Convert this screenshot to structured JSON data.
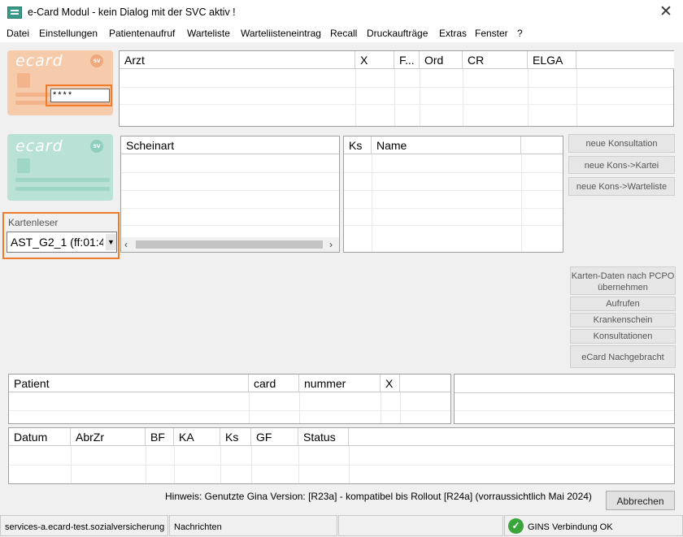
{
  "window": {
    "title": "e-Card Modul - kein Dialog mit der SVC aktiv !",
    "close_glyph": "✕"
  },
  "menu": [
    "Datei",
    "Einstellungen",
    "Patientenaufruf",
    "Warteliste",
    "Warteliisteneintrag",
    "Recall",
    "Druckaufträge",
    "Extras",
    "Fenster",
    "?"
  ],
  "ecard_top": {
    "logo": "ecard",
    "pin_value": "****",
    "sv": "sv"
  },
  "ecard_bottom": {
    "logo": "ecard",
    "sv": "sv"
  },
  "arzt_table": {
    "columns": [
      "Arzt",
      "X",
      "F...",
      "Ord",
      "CR",
      "ELGA"
    ]
  },
  "schein_table": {
    "columns": [
      "Scheinart"
    ]
  },
  "ks_table": {
    "columns": [
      "Ks",
      "Name"
    ]
  },
  "buttons_top": [
    "neue Konsultation",
    "neue Kons->Kartei",
    "neue Kons->Warteliste"
  ],
  "kartenleser": {
    "label": "Kartenleser",
    "value": "AST_G2_1 (ff:01:4"
  },
  "buttons_right": [
    "Karten-Daten nach PCPO übernehmen",
    "Aufrufen",
    "Krankenschein",
    "Konsultationen",
    "eCard Nachgebracht"
  ],
  "patient_table": {
    "columns": [
      "Patient",
      "card",
      "nummer",
      "X"
    ]
  },
  "datum_table": {
    "columns": [
      "Datum",
      "AbrZr",
      "BF",
      "KA",
      "Ks",
      "GF",
      "Status"
    ]
  },
  "hint": "Hinweis: Genutzte Gina Version: [R23a] - kompatibel bis Rollout [R24a] (vorraussichtlich Mai 2024)",
  "abbrechen": "Abbrechen",
  "statusbar": {
    "server": "services-a.ecard-test.sozialversicherung",
    "messages": "Nachrichten",
    "gins": "GINS Verbindung OK"
  },
  "colors": {
    "highlight": "#f07c2a",
    "card_top": "#f7c9a9",
    "card_bottom": "#b6e0d4",
    "ok_green": "#3aa53a"
  }
}
